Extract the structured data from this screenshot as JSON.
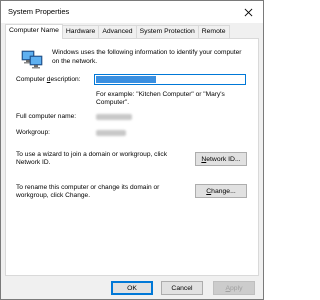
{
  "window": {
    "title": "System Properties"
  },
  "tabs": [
    {
      "label": "Computer Name"
    },
    {
      "label": "Hardware"
    },
    {
      "label": "Advanced"
    },
    {
      "label": "System Protection"
    },
    {
      "label": "Remote"
    }
  ],
  "intro": "Windows uses the following information to identify your computer on the network.",
  "description": {
    "label_pre": "Computer ",
    "label_underlined": "d",
    "label_post": "escription:",
    "example": "For example: \"Kitchen Computer\" or \"Mary's Computer\"."
  },
  "full_name": {
    "label": "Full computer name:"
  },
  "workgroup": {
    "label": "Workgroup:"
  },
  "domain_wizard": {
    "text": "To use a wizard to join a domain or workgroup, click Network ID.",
    "button_pre": "",
    "button_u": "N",
    "button_post": "etwork ID..."
  },
  "rename": {
    "text": "To rename this computer or change its domain or workgroup, click Change.",
    "button_pre": "",
    "button_u": "C",
    "button_post": "hange..."
  },
  "footer": {
    "ok": "OK",
    "cancel": "Cancel",
    "apply_pre": "",
    "apply_u": "A",
    "apply_post": "pply"
  },
  "icons": {
    "close": "close-icon",
    "computer": "computer-network-icon"
  }
}
